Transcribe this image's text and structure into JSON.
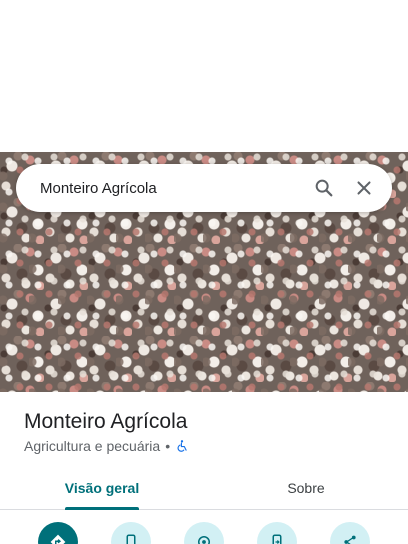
{
  "search": {
    "query": "Monteiro Agrícola"
  },
  "place": {
    "name": "Monteiro Agrícola",
    "category": "Agricultura e pecuária",
    "separator": "•"
  },
  "tabs": [
    {
      "label": "Visão geral",
      "active": true
    },
    {
      "label": "Sobre",
      "active": false
    }
  ],
  "actions": [
    {
      "icon": "directions-icon",
      "primary": true
    },
    {
      "icon": "phone-icon",
      "primary": false
    },
    {
      "icon": "nearby-icon",
      "primary": false
    },
    {
      "icon": "send-to-phone-icon",
      "primary": false
    },
    {
      "icon": "share-icon",
      "primary": false
    }
  ],
  "colors": {
    "accent": "#00707a",
    "action_bg": "#d2f0f4",
    "accessibility_icon": "#1a73e8"
  }
}
